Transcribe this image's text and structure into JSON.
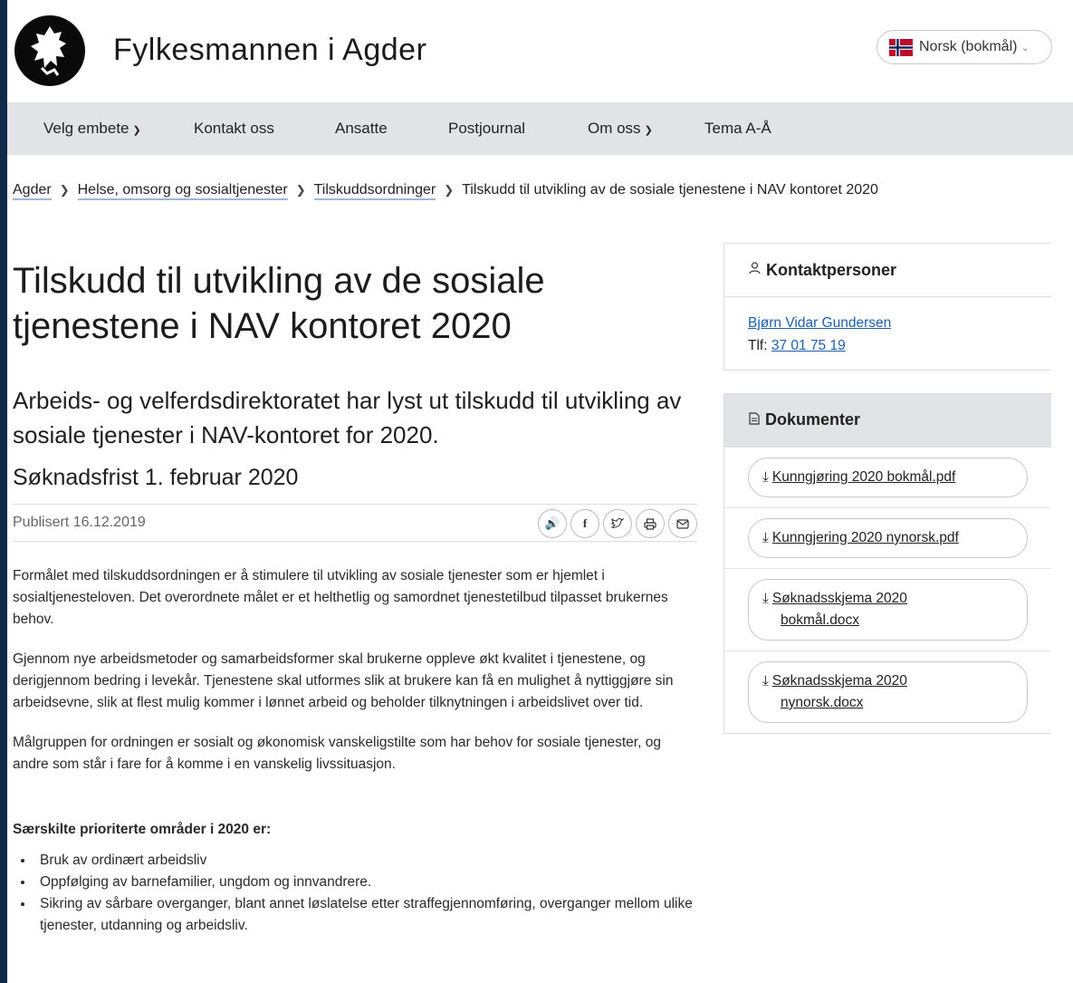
{
  "header": {
    "site_title": "Fylkesmannen i Agder",
    "language": "Norsk (bokmål)"
  },
  "nav": [
    "Velg embete",
    "Kontakt oss",
    "Ansatte",
    "Postjournal",
    "Om oss",
    "Tema A-Å"
  ],
  "breadcrumb": [
    "Agder",
    "Helse, omsorg og sosialtjenester",
    "Tilskuddsordninger",
    "Tilskudd til utvikling av de sosiale tjenestene i NAV kontoret 2020"
  ],
  "article": {
    "title_line1": "Tilskudd til utvikling av de sosiale",
    "title_line2": "tjenestene i NAV kontoret 2020",
    "ingress": "Arbeids- og velferdsdirektoratet har lyst ut tilskudd til utvikling av sosiale tjenester i NAV-kontoret for 2020.",
    "deadline": "Søknadsfrist 1. februar 2020",
    "published": "Publisert 16.12.2019",
    "paragraphs": [
      "Formålet med tilskuddsordningen er å stimulere til utvikling av sosiale tjenester som er hjemlet i sosialtjenesteloven. Det overordnete målet er et helthetlig og samordnet tjenestetilbud tilpasset brukernes behov.",
      "Gjennom nye arbeidsmetoder og samarbeidsformer skal brukerne oppleve økt kvalitet i tjenestene, og derigjennom bedring i levekår. Tjenestene skal utformes slik at brukere kan få en mulighet å nyttiggjøre sin arbeidsevne, slik at flest mulig kommer i lønnet arbeid og beholder tilknytningen i arbeidslivet over tid.",
      "Målgruppen for ordningen er sosialt og økonomisk vanskeligstilte som har behov for sosiale tjenester, og andre som står i fare for å komme i en vanskelig livssituasjon."
    ],
    "priorities_heading": "Særskilte prioriterte områder i 2020 er:",
    "priorities": [
      "Bruk av ordinært arbeidsliv",
      "Oppfølging av barnefamilier, ungdom og innvandrere.",
      "Sikring av sårbare overganger, blant annet løslatelse etter straffegjennomføring, overganger mellom ulike tjenester, utdanning og arbeidsliv."
    ]
  },
  "sidebar": {
    "contacts_title": "Kontaktpersoner",
    "contact_name": "Bjørn Vidar Gundersen",
    "phone_label": "Tlf:",
    "phone": "37 01 75 19",
    "documents_title": "Dokumenter",
    "documents": [
      {
        "line1": "Kunngjøring 2020 bokmål.pdf",
        "line2": ""
      },
      {
        "line1": "Kunngjering 2020 nynorsk.pdf",
        "line2": ""
      },
      {
        "line1": "Søknadsskjema 2020",
        "line2": "bokmål.docx"
      },
      {
        "line1": "Søknadsskjema 2020",
        "line2": "nynorsk.docx"
      }
    ]
  },
  "icons": {
    "share": [
      "speaker-icon",
      "facebook-icon",
      "twitter-icon",
      "print-icon",
      "email-icon"
    ]
  }
}
